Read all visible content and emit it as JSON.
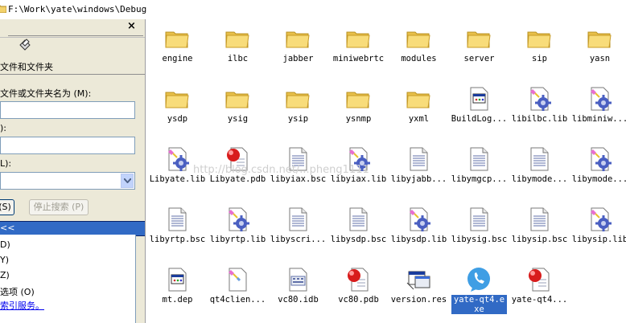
{
  "address": {
    "path": "F:\\Work\\yate\\windows\\Debug"
  },
  "search_pane": {
    "close": "×",
    "section_title": "文件和文件夹",
    "name_label": "文件或文件夹名为 (M):",
    "name_value": "",
    "text_label": "):",
    "text_value": "",
    "location_label": "L):",
    "location_value": "",
    "search_button": "(S)",
    "stop_button": "停止搜索 (P)",
    "advanced": "<<",
    "options": [
      "D)",
      "Y)",
      "Z)",
      "选项 (O)"
    ],
    "link": "索引服务。"
  },
  "files": [
    {
      "name": "engine",
      "icon": "folder-icon"
    },
    {
      "name": "ilbc",
      "icon": "folder-icon"
    },
    {
      "name": "jabber",
      "icon": "folder-icon"
    },
    {
      "name": "miniwebrtc",
      "icon": "folder-icon"
    },
    {
      "name": "modules",
      "icon": "folder-icon"
    },
    {
      "name": "server",
      "icon": "folder-icon"
    },
    {
      "name": "sip",
      "icon": "folder-icon"
    },
    {
      "name": "yasn",
      "icon": "folder-icon"
    },
    {
      "name": "ysdp",
      "icon": "folder-icon"
    },
    {
      "name": "ysig",
      "icon": "folder-icon"
    },
    {
      "name": "ysip",
      "icon": "folder-icon"
    },
    {
      "name": "ysnmp",
      "icon": "folder-icon"
    },
    {
      "name": "yxml",
      "icon": "folder-icon"
    },
    {
      "name": "BuildLog...",
      "icon": "html-document-icon"
    },
    {
      "name": "libilbc.lib",
      "icon": "lib-gear-icon"
    },
    {
      "name": "libminiw...",
      "icon": "lib-gear-icon"
    },
    {
      "name": "Libyate.lib",
      "icon": "lib-gear-icon"
    },
    {
      "name": "Libyate.pdb",
      "icon": "pdb-red-ball-icon"
    },
    {
      "name": "libyiax.bsc",
      "icon": "text-document-icon"
    },
    {
      "name": "libyiax.lib",
      "icon": "lib-gear-icon"
    },
    {
      "name": "libyjabb...",
      "icon": "text-document-icon"
    },
    {
      "name": "libymgcp...",
      "icon": "text-document-icon"
    },
    {
      "name": "libymode...",
      "icon": "text-document-icon"
    },
    {
      "name": "libymode...",
      "icon": "lib-gear-icon"
    },
    {
      "name": "libyrtp.bsc",
      "icon": "text-document-icon"
    },
    {
      "name": "libyrtp.lib",
      "icon": "lib-gear-icon"
    },
    {
      "name": "libyscri...",
      "icon": "text-document-icon"
    },
    {
      "name": "libysdp.bsc",
      "icon": "text-document-icon"
    },
    {
      "name": "libysdp.lib",
      "icon": "lib-gear-icon"
    },
    {
      "name": "libysig.bsc",
      "icon": "text-document-icon"
    },
    {
      "name": "libysip.bsc",
      "icon": "text-document-icon"
    },
    {
      "name": "libysip.lib",
      "icon": "lib-gear-icon"
    },
    {
      "name": "mt.dep",
      "icon": "html-document-icon"
    },
    {
      "name": "qt4clien...",
      "icon": "lib-pen-icon"
    },
    {
      "name": "vc80.idb",
      "icon": "idb-document-icon"
    },
    {
      "name": "vc80.pdb",
      "icon": "pdb-red-ball-icon"
    },
    {
      "name": "version.res",
      "icon": "res-window-icon"
    },
    {
      "name": "yate-qt4.exe",
      "icon": "yate-phone-icon",
      "selected": true
    },
    {
      "name": "yate-qt4...",
      "icon": "pdb-red-ball-icon"
    }
  ],
  "watermark": "http://blog.csdn.net/...pheng1111",
  "colors": {
    "selection": "#316ac5",
    "folder": "#f5d76e",
    "gear": "#4a5fc1",
    "ball": "#d81c1c"
  }
}
